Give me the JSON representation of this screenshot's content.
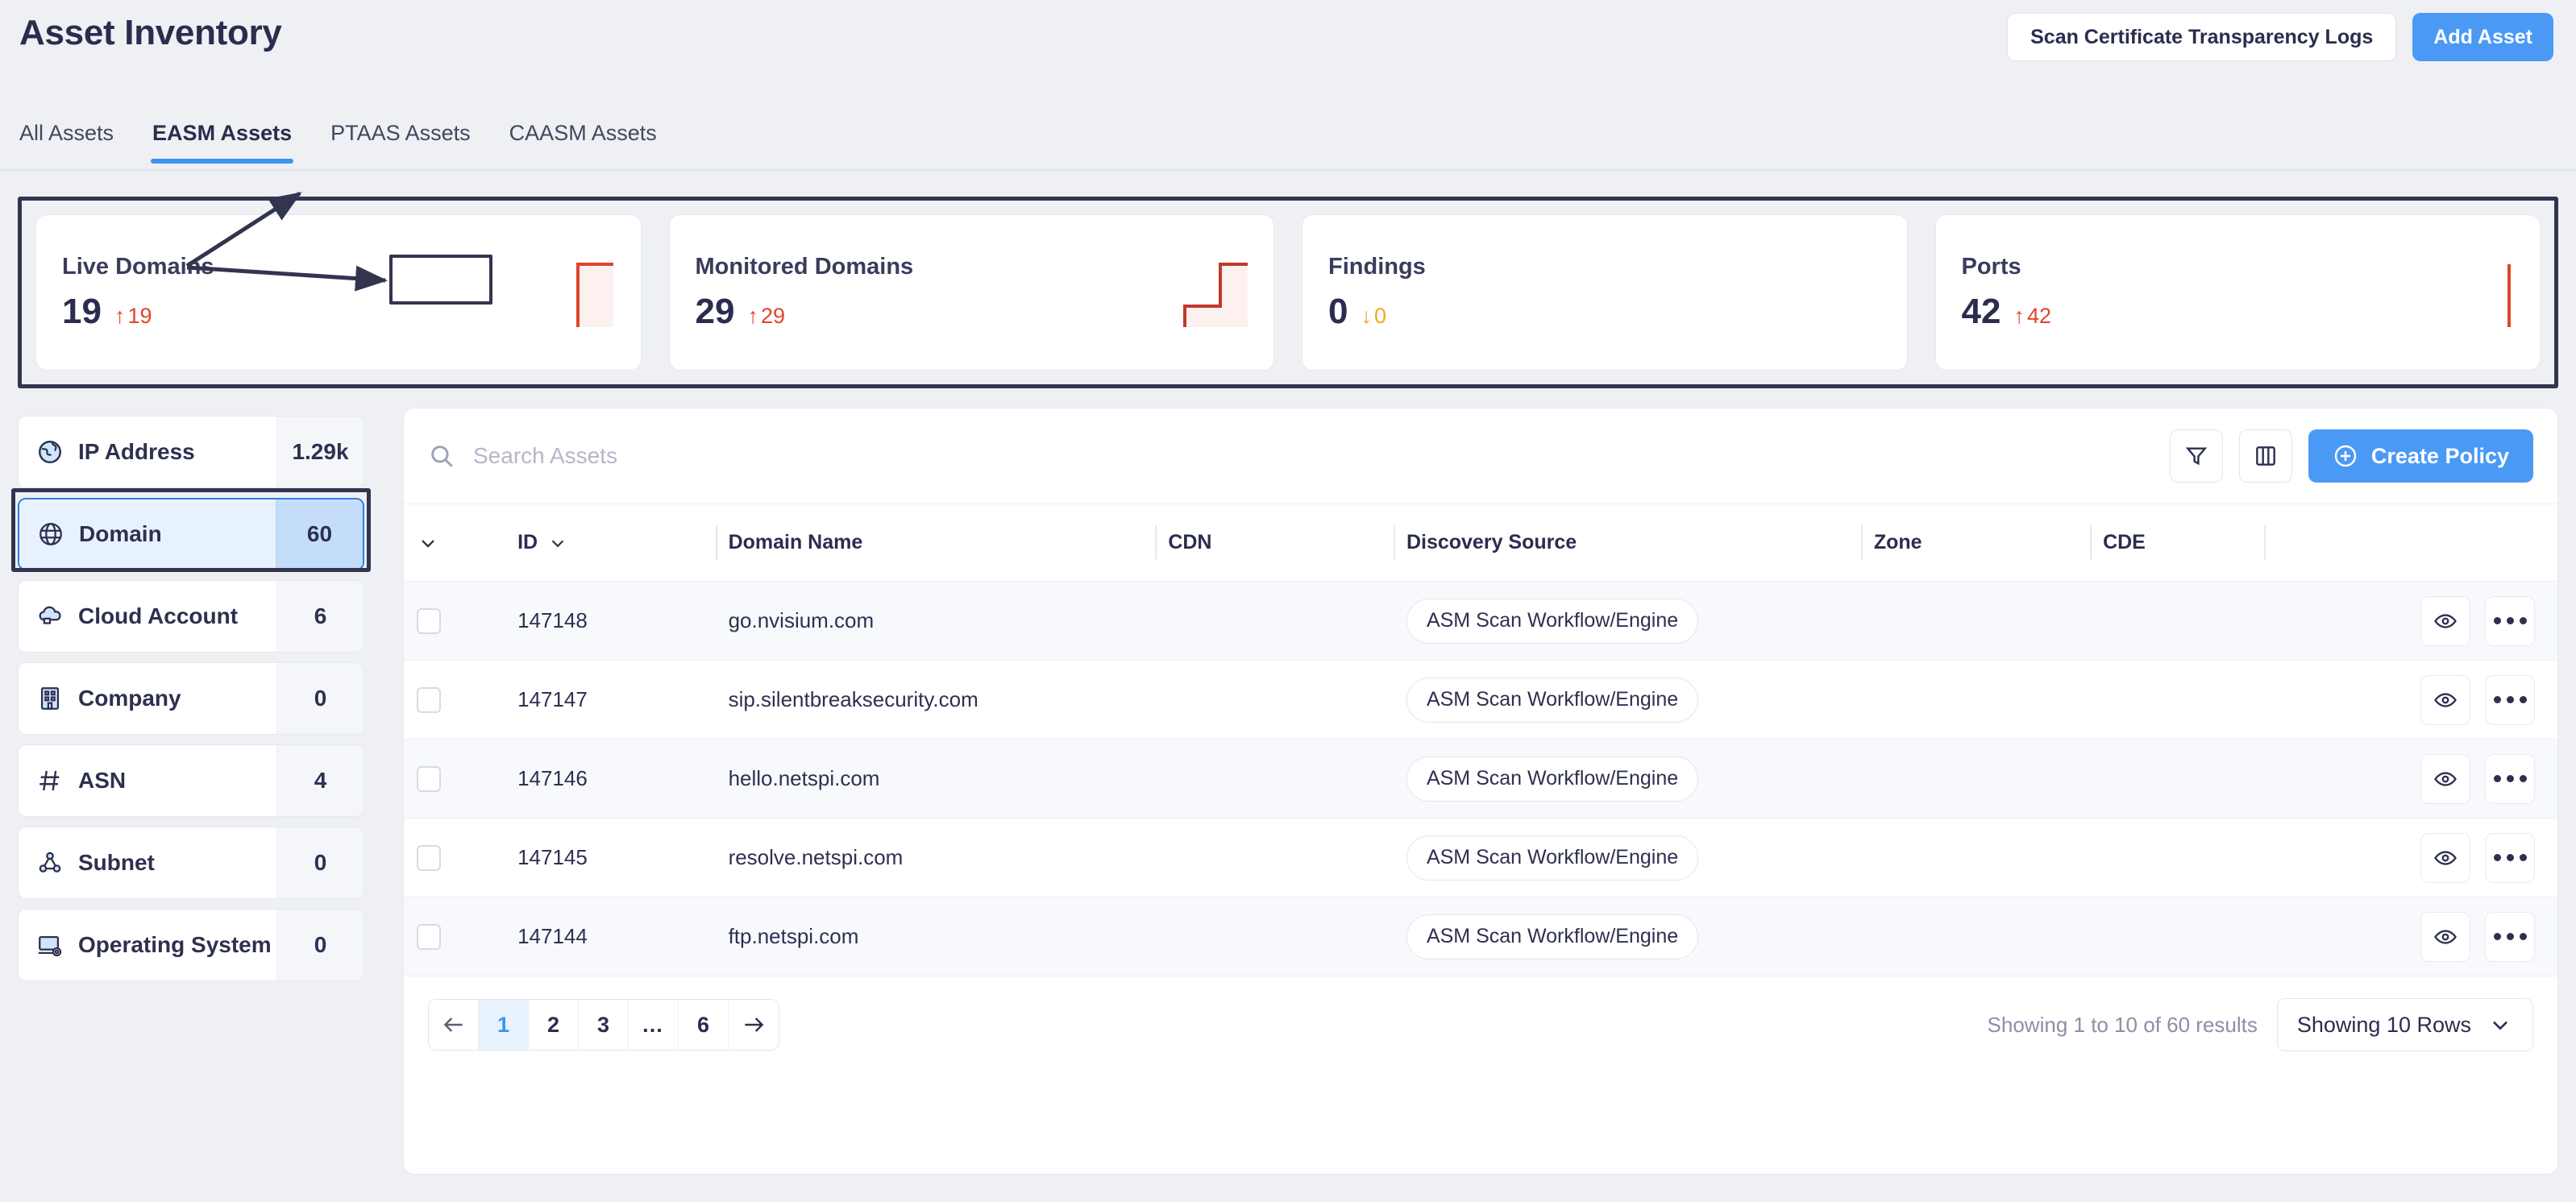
{
  "header": {
    "title": "Asset Inventory",
    "scan_button": "Scan Certificate Transparency Logs",
    "add_button": "Add Asset"
  },
  "tabs": [
    {
      "label": "All Assets",
      "active": false
    },
    {
      "label": "EASM Assets",
      "active": true
    },
    {
      "label": "PTAAS Assets",
      "active": false
    },
    {
      "label": "CAASM Assets",
      "active": false
    }
  ],
  "kpis": [
    {
      "label": "Live Domains",
      "value": "19",
      "delta": "19",
      "direction": "up",
      "color": "#e0452b"
    },
    {
      "label": "Monitored Domains",
      "value": "29",
      "delta": "29",
      "direction": "up",
      "color": "#e0452b"
    },
    {
      "label": "Findings",
      "value": "0",
      "delta": "0",
      "direction": "down",
      "color": "#f4a62a"
    },
    {
      "label": "Ports",
      "value": "42",
      "delta": "42",
      "direction": "up",
      "color": "#e0452b"
    }
  ],
  "facets": [
    {
      "label": "IP Address",
      "count": "1.29k",
      "icon": "globe-americas-icon",
      "selected": false
    },
    {
      "label": "Domain",
      "count": "60",
      "icon": "globe-icon",
      "selected": true
    },
    {
      "label": "Cloud Account",
      "count": "6",
      "icon": "cloud-icon",
      "selected": false
    },
    {
      "label": "Company",
      "count": "0",
      "icon": "building-icon",
      "selected": false
    },
    {
      "label": "ASN",
      "count": "4",
      "icon": "hash-icon",
      "selected": false
    },
    {
      "label": "Subnet",
      "count": "0",
      "icon": "network-icon",
      "selected": false
    },
    {
      "label": "Operating System",
      "count": "0",
      "icon": "monitor-gear-icon",
      "selected": false
    }
  ],
  "toolbar": {
    "search_placeholder": "Search Assets",
    "search_value": "",
    "filter_icon": "filter-icon",
    "columns_icon": "columns-icon",
    "create_policy": "Create Policy"
  },
  "table": {
    "columns": [
      {
        "key": "select",
        "label": ""
      },
      {
        "key": "id",
        "label": "ID"
      },
      {
        "key": "domain",
        "label": "Domain Name"
      },
      {
        "key": "cdn",
        "label": "CDN"
      },
      {
        "key": "source",
        "label": "Discovery Source"
      },
      {
        "key": "zone",
        "label": "Zone"
      },
      {
        "key": "cde",
        "label": "CDE"
      },
      {
        "key": "actions",
        "label": ""
      }
    ],
    "rows": [
      {
        "id": "147148",
        "domain": "go.nvisium.com",
        "cdn": "",
        "source": "ASM Scan Workflow/Engine",
        "zone": "",
        "cde": ""
      },
      {
        "id": "147147",
        "domain": "sip.silentbreaksecurity.com",
        "cdn": "",
        "source": "ASM Scan Workflow/Engine",
        "zone": "",
        "cde": ""
      },
      {
        "id": "147146",
        "domain": "hello.netspi.com",
        "cdn": "",
        "source": "ASM Scan Workflow/Engine",
        "zone": "",
        "cde": ""
      },
      {
        "id": "147145",
        "domain": "resolve.netspi.com",
        "cdn": "",
        "source": "ASM Scan Workflow/Engine",
        "zone": "",
        "cde": ""
      },
      {
        "id": "147144",
        "domain": "ftp.netspi.com",
        "cdn": "",
        "source": "ASM Scan Workflow/Engine",
        "zone": "",
        "cde": ""
      }
    ]
  },
  "footer": {
    "prev_icon": "arrow-left-icon",
    "next_icon": "arrow-right-icon",
    "pages": [
      "1",
      "2",
      "3",
      "…",
      "6"
    ],
    "current_page": "1",
    "results_text": "Showing 1 to 10 of 60 results",
    "rows_per_page": "Showing 10 Rows"
  },
  "annotations": {
    "accent": "#33354f",
    "highlight_kpi_row": true,
    "highlight_facet_domain": true,
    "highlight_domain_name_header": true
  }
}
